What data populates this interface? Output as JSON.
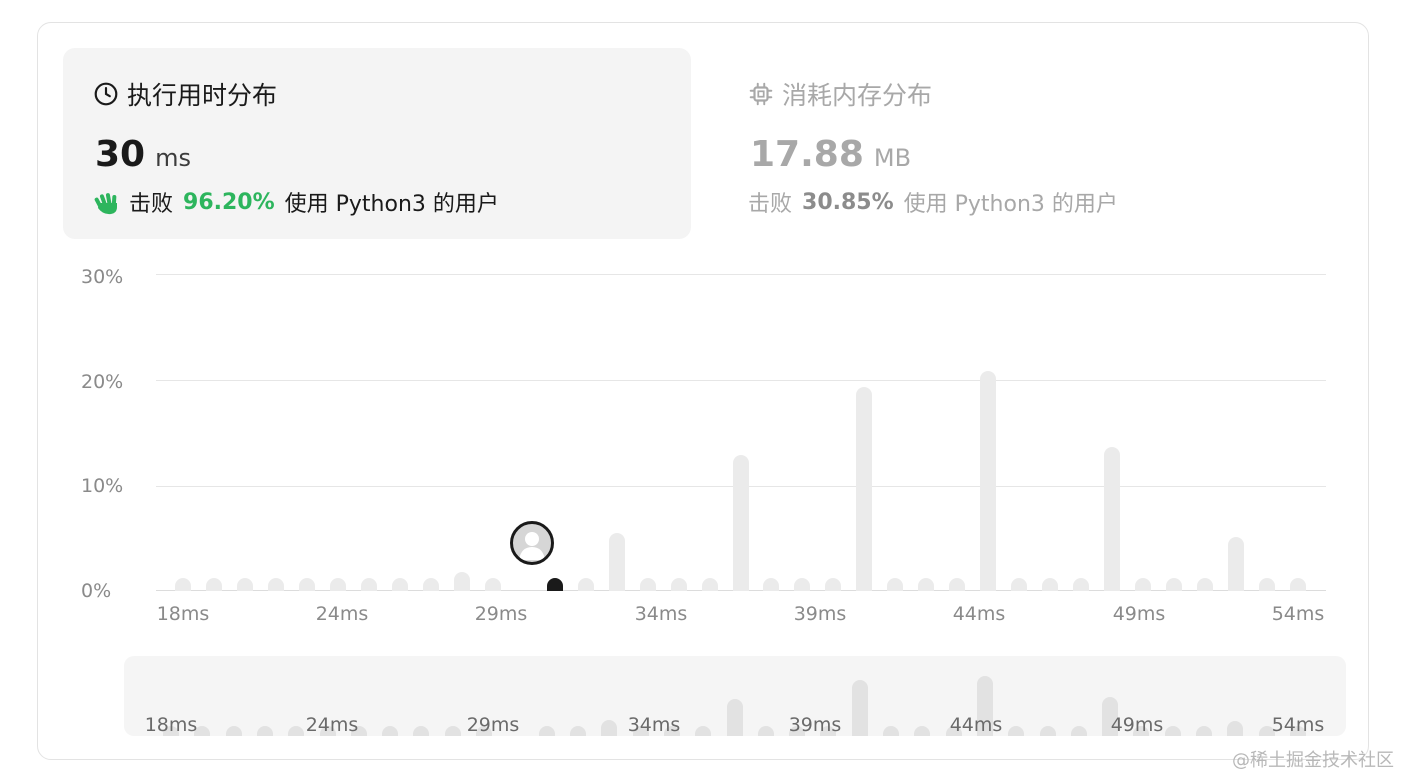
{
  "runtime": {
    "title": "执行用时分布",
    "value": "30",
    "unit": "ms",
    "beat_prefix": "击败",
    "beat_percent": "96.20%",
    "beat_suffix": "使用 Python3 的用户",
    "icon": "clock-icon",
    "highlight_color": "#2db55d"
  },
  "memory": {
    "title": "消耗内存分布",
    "value": "17.88",
    "unit": "MB",
    "beat_prefix": "击败",
    "beat_percent": "30.85%",
    "beat_suffix": "使用 Python3 的用户",
    "icon": "chip-icon"
  },
  "chart_data": {
    "type": "bar",
    "title": "",
    "xlabel": "",
    "ylabel": "",
    "ylim": [
      0,
      30
    ],
    "y_ticks": [
      "30%",
      "20%",
      "10%",
      "0%"
    ],
    "x_tick_labels": [
      "18ms",
      "24ms",
      "29ms",
      "34ms",
      "39ms",
      "44ms",
      "49ms",
      "54ms"
    ],
    "current_value_ms": 30,
    "series": [
      {
        "values": [
          {
            "x": 18,
            "y": 0.5
          },
          {
            "x": 19,
            "y": 0.5
          },
          {
            "x": 20,
            "y": 0.5
          },
          {
            "x": 21,
            "y": 0.5
          },
          {
            "x": 22,
            "y": 0.5
          },
          {
            "x": 23,
            "y": 0.5
          },
          {
            "x": 24,
            "y": 0.5
          },
          {
            "x": 25,
            "y": 0.5
          },
          {
            "x": 26,
            "y": 0.5
          },
          {
            "x": 27,
            "y": 1.8
          },
          {
            "x": 28,
            "y": 0.5
          },
          {
            "x": 30,
            "y": 0.5
          },
          {
            "x": 31,
            "y": 0.5
          },
          {
            "x": 32,
            "y": 5.5
          },
          {
            "x": 33,
            "y": 0.5
          },
          {
            "x": 34,
            "y": 0.5
          },
          {
            "x": 35,
            "y": 0.9
          },
          {
            "x": 36,
            "y": 12.9
          },
          {
            "x": 37,
            "y": 0.5
          },
          {
            "x": 38,
            "y": 0.5
          },
          {
            "x": 39,
            "y": 1.1
          },
          {
            "x": 40,
            "y": 19.3
          },
          {
            "x": 41,
            "y": 0.5
          },
          {
            "x": 42,
            "y": 0.5
          },
          {
            "x": 43,
            "y": 0.5
          },
          {
            "x": 44,
            "y": 20.8
          },
          {
            "x": 45,
            "y": 0.5
          },
          {
            "x": 46,
            "y": 0.5
          },
          {
            "x": 47,
            "y": 0.5
          },
          {
            "x": 48,
            "y": 13.6
          },
          {
            "x": 49,
            "y": 0.5
          },
          {
            "x": 50,
            "y": 0.5
          },
          {
            "x": 51,
            "y": 0.5
          },
          {
            "x": 52,
            "y": 5.1
          },
          {
            "x": 53,
            "y": 0.5
          },
          {
            "x": 54,
            "y": 0.5
          }
        ]
      }
    ],
    "current": {
      "x": 30,
      "y": 0.5
    },
    "grid": true
  },
  "watermark": "@稀土掘金技术社区"
}
